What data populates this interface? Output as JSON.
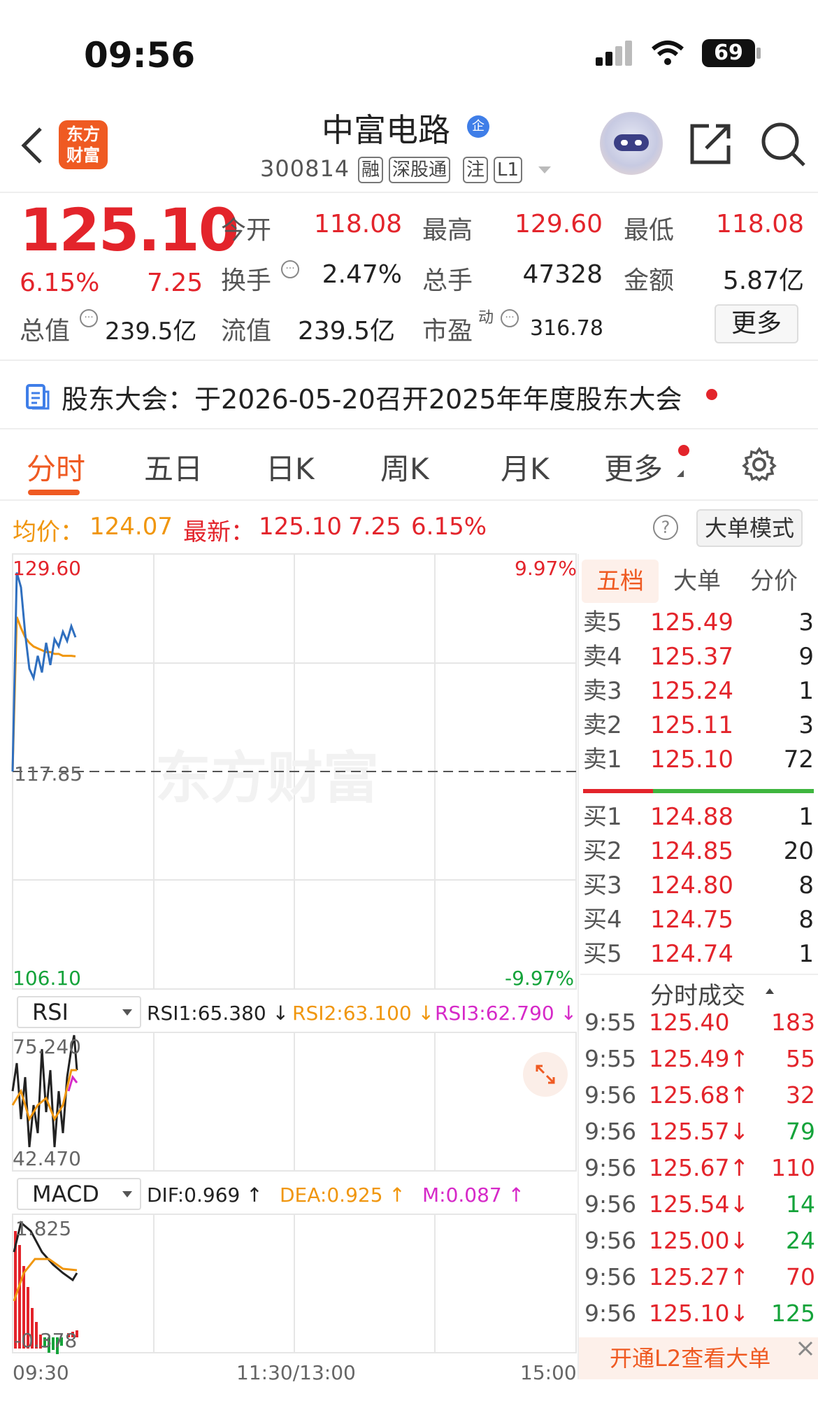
{
  "status_bar": {
    "time": "09:56",
    "battery": "69"
  },
  "header": {
    "logo_text": "东方\n财富",
    "stock_name": "中富电路",
    "badge": "企",
    "code": "300814",
    "tags": [
      "融",
      "深股通",
      "注",
      "L1"
    ]
  },
  "quote": {
    "price": "125.10",
    "change_pct": "6.15%",
    "change": "7.25",
    "open_label": "今开",
    "open": "118.08",
    "high_label": "最高",
    "high": "129.60",
    "low_label": "最低",
    "low": "118.08",
    "turnover_label": "换手",
    "turnover": "2.47%",
    "volume_label": "总手",
    "volume": "47328",
    "amount_label": "金额",
    "amount": "5.87亿",
    "mktcap_label": "总值",
    "mktcap": "239.5亿",
    "float_label": "流值",
    "float": "239.5亿",
    "pe_label": "市盈",
    "pe_sup": "动",
    "pe": "316.78",
    "more_btn": "更多"
  },
  "notice": "股东大会：于2026-05-20召开2025年年度股东大会",
  "tabs": [
    "分时",
    "五日",
    "日K",
    "周K",
    "月K",
    "更多"
  ],
  "summary": {
    "avg_label": "均价：",
    "avg": "124.07",
    "last_label": "最新：",
    "last": "125.10",
    "chg": "7.25",
    "pct": "6.15%",
    "help": "?",
    "mode_btn": "大单模式"
  },
  "chart_labels": {
    "top_left": "129.60",
    "top_right": "9.97%",
    "mid_left": "117.85",
    "bottom_left": "106.10",
    "bottom_right": "-9.97%",
    "watermark": "东方财富",
    "rsi_select": "RSI",
    "rsi1": "RSI1:65.380 ↓",
    "rsi2": "RSI2:63.100 ↓",
    "rsi3": "RSI3:62.790 ↓",
    "rsi_top": "75.240",
    "rsi_bottom": "42.470",
    "macd_select": "MACD",
    "dif": "DIF:0.969 ↑",
    "dea": "DEA:0.925 ↑",
    "m": "M:0.087 ↑",
    "macd_top": "1.825",
    "macd_bottom": "-0.378",
    "time_start": "09:30",
    "time_mid": "11:30/13:00",
    "time_end": "15:00"
  },
  "order_book": {
    "tabs": [
      "五档",
      "大单",
      "分价"
    ],
    "asks": [
      {
        "label": "卖5",
        "price": "125.49",
        "qty": "3"
      },
      {
        "label": "卖4",
        "price": "125.37",
        "qty": "9"
      },
      {
        "label": "卖3",
        "price": "125.24",
        "qty": "1"
      },
      {
        "label": "卖2",
        "price": "125.11",
        "qty": "3"
      },
      {
        "label": "卖1",
        "price": "125.10",
        "qty": "72"
      }
    ],
    "bids": [
      {
        "label": "买1",
        "price": "124.88",
        "qty": "1"
      },
      {
        "label": "买2",
        "price": "124.85",
        "qty": "20"
      },
      {
        "label": "买3",
        "price": "124.80",
        "qty": "8"
      },
      {
        "label": "买4",
        "price": "124.75",
        "qty": "8"
      },
      {
        "label": "买5",
        "price": "124.74",
        "qty": "1"
      }
    ]
  },
  "trades": {
    "title": "分时成交",
    "rows": [
      {
        "time": "9:55",
        "price": "125.40",
        "vol": "183",
        "price_color": "red",
        "vol_color": "red"
      },
      {
        "time": "9:55",
        "price": "125.49↑",
        "vol": "55",
        "price_color": "red",
        "vol_color": "red"
      },
      {
        "time": "9:56",
        "price": "125.68↑",
        "vol": "32",
        "price_color": "red",
        "vol_color": "red"
      },
      {
        "time": "9:56",
        "price": "125.57↓",
        "vol": "79",
        "price_color": "red",
        "vol_color": "green"
      },
      {
        "time": "9:56",
        "price": "125.67↑",
        "vol": "110",
        "price_color": "red",
        "vol_color": "red"
      },
      {
        "time": "9:56",
        "price": "125.54↓",
        "vol": "14",
        "price_color": "red",
        "vol_color": "green"
      },
      {
        "time": "9:56",
        "price": "125.00↓",
        "vol": "24",
        "price_color": "red",
        "vol_color": "green"
      },
      {
        "time": "9:56",
        "price": "125.27↑",
        "vol": "70",
        "price_color": "red",
        "vol_color": "red"
      },
      {
        "time": "9:56",
        "price": "125.10↓",
        "vol": "125",
        "price_color": "red",
        "vol_color": "green"
      }
    ]
  },
  "l2_banner": "开通L2查看大单",
  "colors": {
    "up": "#e3242b",
    "down": "#14a33a",
    "accent": "#ef5a22",
    "price_line": "#2f6fbf",
    "avg_line": "#f0960e"
  },
  "chart_data": {
    "type": "line",
    "series": [
      {
        "values": [
          117.85,
          128.6,
          127.8,
          125.3,
          123.4,
          122.9,
          124.1,
          123.2,
          124.8,
          123.6,
          125.0,
          124.6,
          125.4,
          124.9,
          125.7,
          125.1
        ]
      },
      {
        "values": [
          117.85,
          126.2,
          125.6,
          125.1,
          124.8,
          124.6,
          124.5,
          124.4,
          124.3,
          124.3,
          124.2,
          124.2,
          124.1,
          124.1,
          124.1,
          124.07
        ]
      }
    ],
    "ylim": [
      106.1,
      129.6
    ],
    "x_categories": [
      "09:30",
      "11:30/13:00",
      "15:00"
    ]
  }
}
